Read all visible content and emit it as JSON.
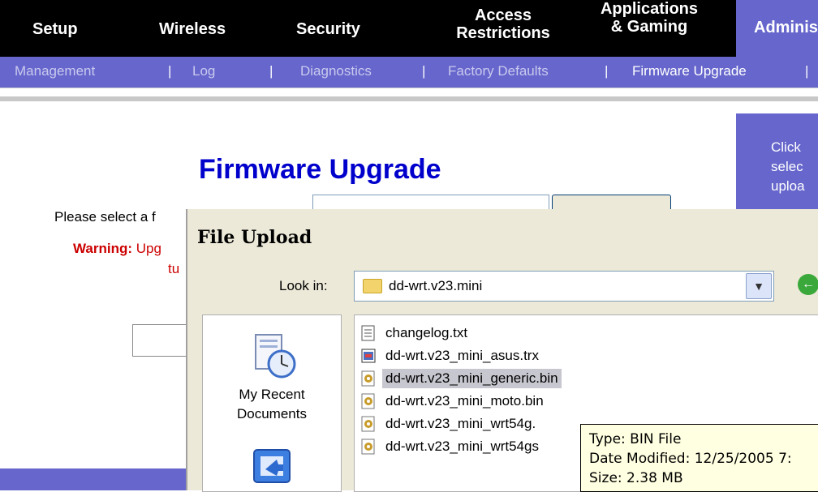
{
  "topnav": {
    "tabs": [
      "Setup",
      "Wireless",
      "Security",
      "Access Restrictions",
      "Applications & Gaming",
      "Adminis"
    ],
    "active": "Adminis"
  },
  "subnav": {
    "items": [
      "Management",
      "Log",
      "Diagnostics",
      "Factory Defaults",
      "Firmware Upgrade"
    ],
    "separator": "|",
    "active": "Firmware Upgrade"
  },
  "help": {
    "lines": [
      "Click",
      "selec",
      "uploa"
    ]
  },
  "page": {
    "title": "Firmware Upgrade",
    "prompt": "Please select a f",
    "warning_label": "Warning:",
    "warning_text": "Upg",
    "warning_line2": "tu"
  },
  "dialog": {
    "title": "File Upload",
    "look_in_label": "Look in:",
    "look_in_value": "dd-wrt.v23.mini",
    "places": [
      {
        "label_line1": "My Recent",
        "label_line2": "Documents",
        "icon": "recent-documents-icon"
      }
    ],
    "files": [
      {
        "name": "changelog.txt",
        "icon": "text-file-icon",
        "selected": false
      },
      {
        "name": "dd-wrt.v23_mini_asus.trx",
        "icon": "trx-file-icon",
        "selected": false
      },
      {
        "name": "dd-wrt.v23_mini_generic.bin",
        "icon": "bin-file-icon",
        "selected": true
      },
      {
        "name": "dd-wrt.v23_mini_moto.bin",
        "icon": "bin-file-icon",
        "selected": false
      },
      {
        "name": "dd-wrt.v23_mini_wrt54g.",
        "icon": "bin-file-icon",
        "selected": false
      },
      {
        "name": "dd-wrt.v23_mini_wrt54gs",
        "icon": "bin-file-icon",
        "selected": false
      }
    ],
    "tooltip": {
      "type": "Type: BIN File",
      "modified": "Date Modified: 12/25/2005 7:",
      "size": "Size: 2.38 MB"
    }
  },
  "colors": {
    "nav_black": "#000000",
    "nav_purple": "#6666cc",
    "title_blue": "#0000cc",
    "warning_red": "#cc0000",
    "dialog_bg": "#ece9d8",
    "selection": "#c7c7cf",
    "tooltip_bg": "#ffffe1"
  }
}
